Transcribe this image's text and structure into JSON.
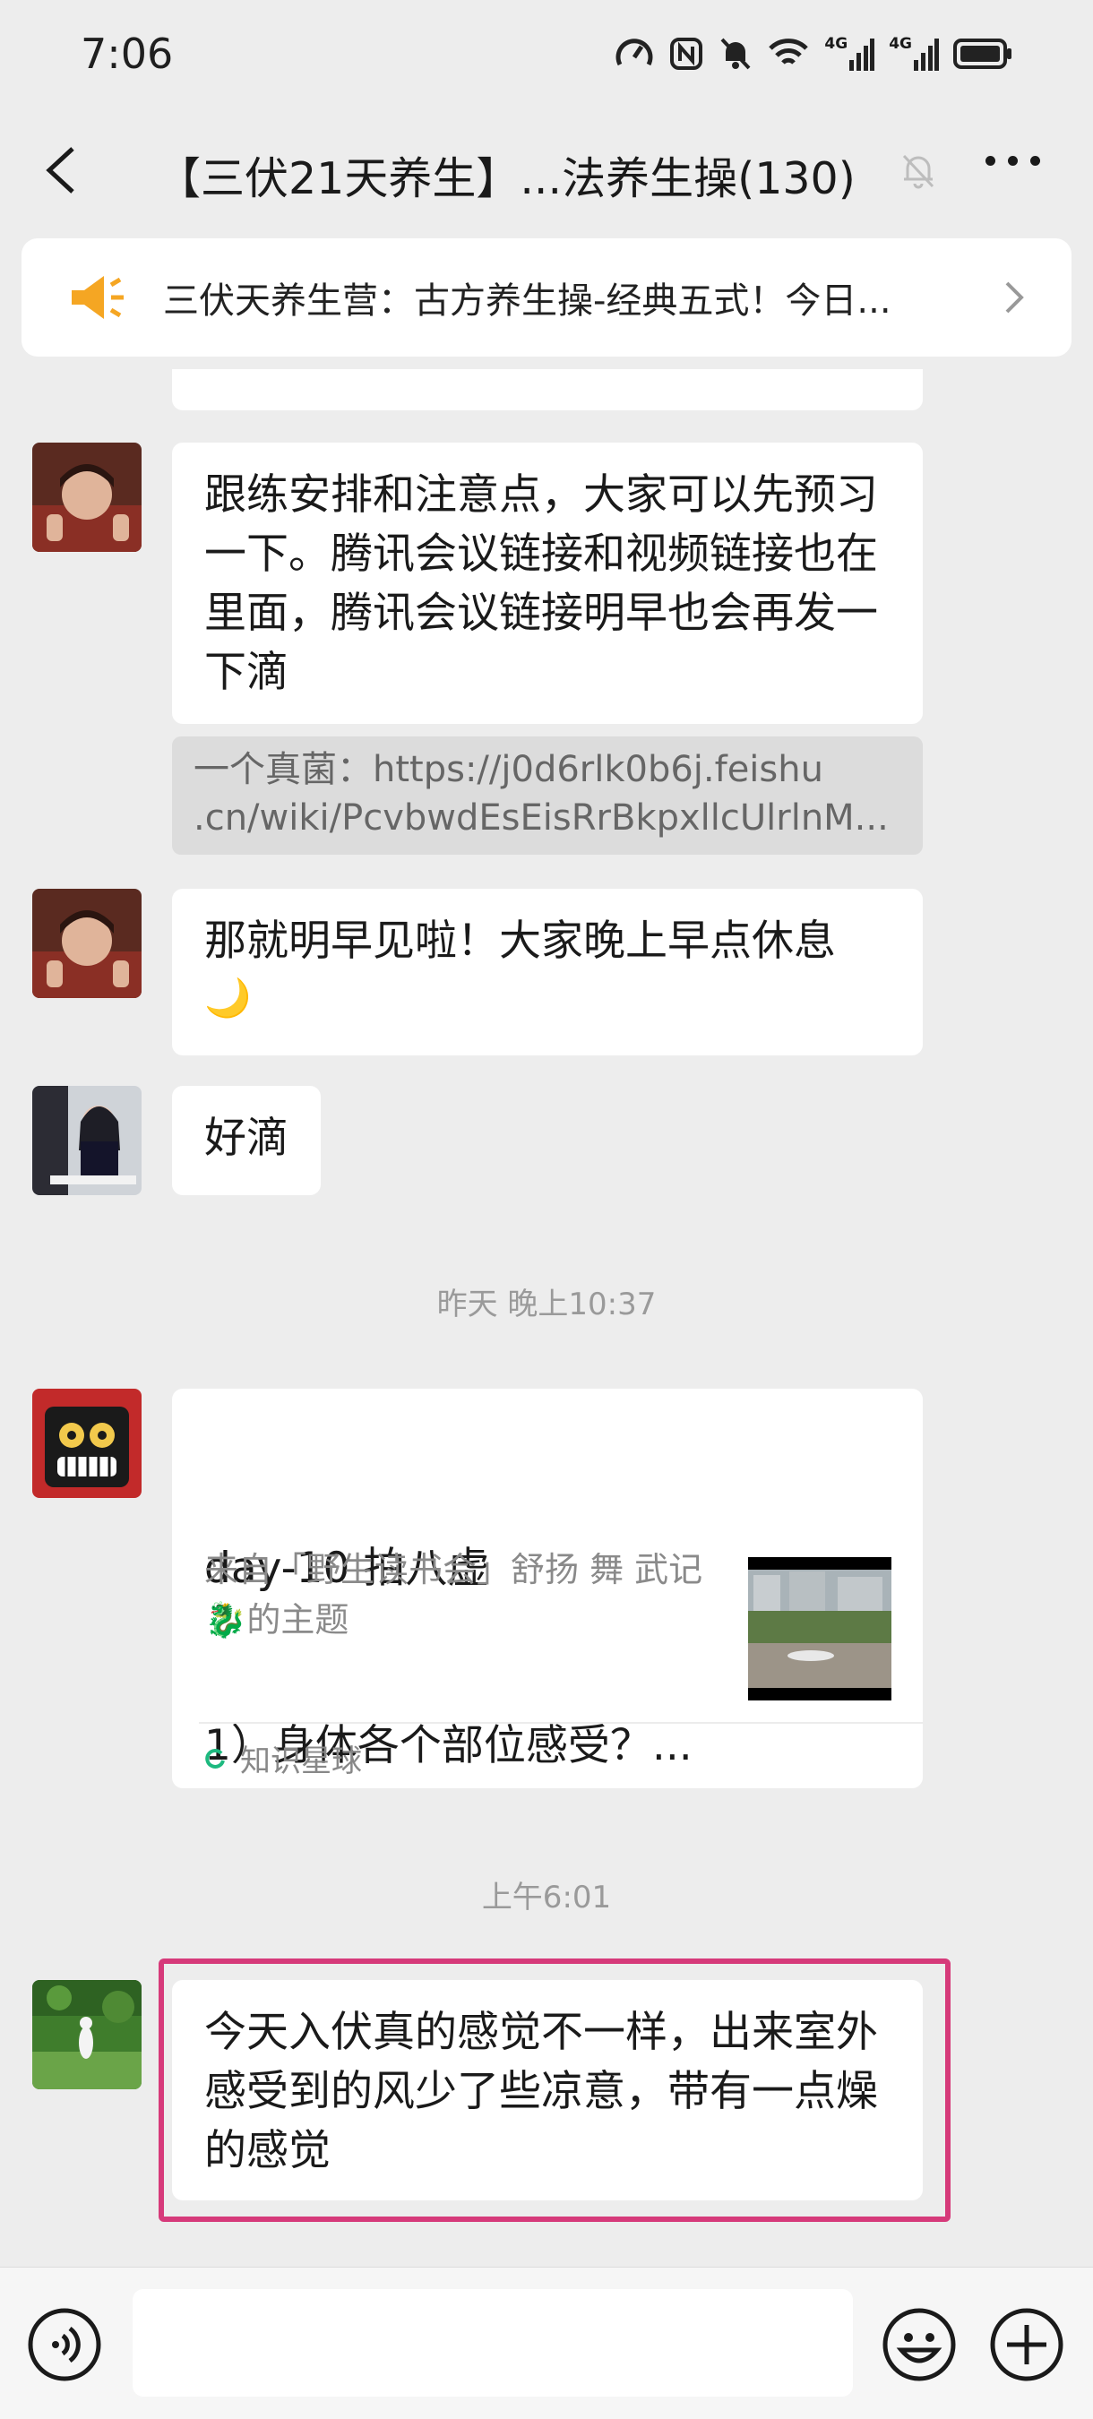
{
  "status_bar": {
    "time": "7:06",
    "net1": "4G",
    "net2": "4G"
  },
  "header": {
    "title": "【三伏21天养生】...法养生操(130)"
  },
  "notice": {
    "text": "三伏天养生营：古方养生操-经典五式！今日..."
  },
  "messages": [
    {
      "text": "跟练安排和注意点，大家可以先预习一下。腾讯会议链接和视频链接也在里面，腾讯会议链接明早也会再发一下滴",
      "quote_line1": "一个真菌：https://j0d6rlk0b6j.feishu",
      "quote_line2": ".cn/wiki/PcvbwdEsEisRrBkpxllcUlrlnM..."
    },
    {
      "text": "那就明早见啦！大家晚上早点休息",
      "emoji": "🌙"
    },
    {
      "text": "好滴"
    },
    {
      "text": "今天入伏真的感觉不一样，出来室外感受到的风少了些凉意，带有一点燥的感觉"
    }
  ],
  "timestamps": {
    "yesterday": "昨天 晚上10:37",
    "morning": "上午6:01"
  },
  "card": {
    "title_line1": "day-10 拍八虚",
    "title_line2": "1）身体各个部位感受？...",
    "desc": "来自「野生读书会」舒扬 舞 武记🐉的主题",
    "source": "知识星球"
  },
  "colors": {
    "background": "#ededed",
    "highlight_border": "#d63a7a",
    "notice_icon": "#f5a623",
    "zsxq_green": "#1db97f"
  }
}
